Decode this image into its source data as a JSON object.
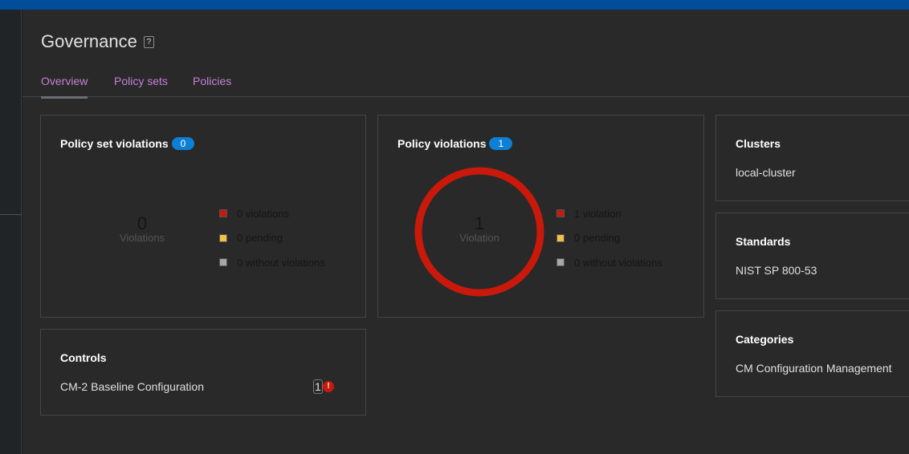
{
  "header": {
    "title": "Governance",
    "help_icon": "help-icon"
  },
  "tabs": [
    {
      "label": "Overview",
      "active": true
    },
    {
      "label": "Policy sets"
    },
    {
      "label": "Policies"
    }
  ],
  "colors": {
    "violation": "#c9190b",
    "pending": "#f4c145",
    "without": "#a8a8a8",
    "badge": "#0d7fd4",
    "tab": "#c680d8"
  },
  "policy_set_violations": {
    "title": "Policy set violations",
    "count": "0",
    "center_value": "0",
    "center_label": "Violations",
    "legend": [
      "0 violations",
      "0 pending",
      "0 without violations"
    ],
    "violations": 0,
    "pending": 0,
    "without": 0
  },
  "policy_violations": {
    "title": "Policy violations",
    "count": "1",
    "center_value": "1",
    "center_label": "Violation",
    "legend": [
      "1 violation",
      "0 pending",
      "0 without violations"
    ],
    "violations": 1,
    "pending": 0,
    "without": 0
  },
  "controls": {
    "title": "Controls",
    "items": [
      {
        "name": "CM-2 Baseline Configuration",
        "count": "1"
      }
    ]
  },
  "clusters": {
    "title": "Clusters",
    "value": "local-cluster"
  },
  "standards": {
    "title": "Standards",
    "value": "NIST SP 800-53"
  },
  "categories": {
    "title": "Categories",
    "value": "CM Configuration Management"
  }
}
